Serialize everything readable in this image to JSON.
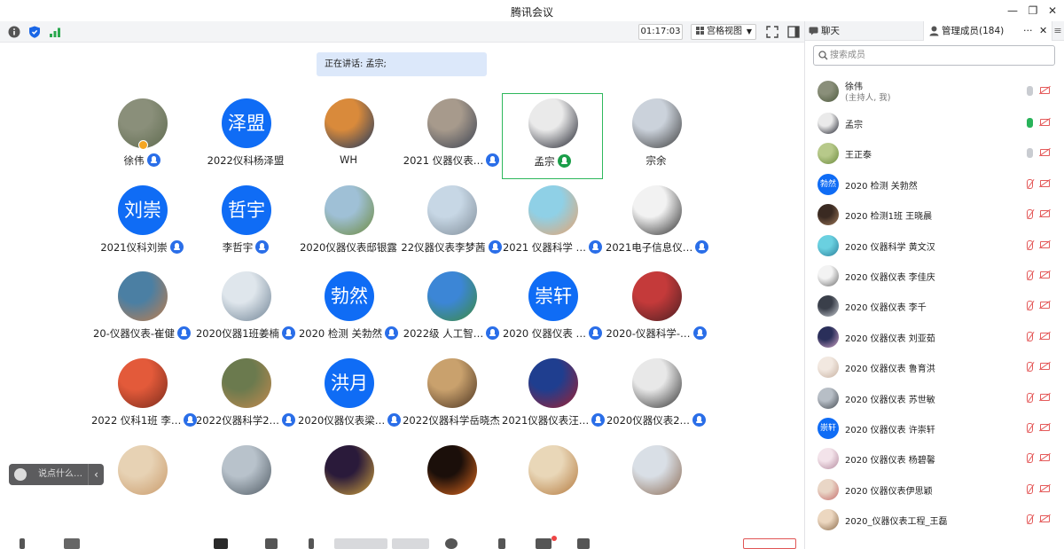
{
  "window": {
    "title": "腾讯会议",
    "minimize": "—",
    "restore": "❐",
    "close": "✕"
  },
  "toolbar": {
    "timer": "01:17:03",
    "view_mode": "宫格视图"
  },
  "speaking_banner": "正在讲话: 孟宗;",
  "colors": {
    "accent": "#0f6cf5",
    "speaking": "#2eb85c",
    "muted": "#e45a5a"
  },
  "tiles": [
    {
      "name": "徐伟",
      "type": "photo",
      "c1": "#8a8f7a",
      "c2": "#5e6a4e",
      "host": true
    },
    {
      "name": "2022仪科杨泽盟",
      "type": "text",
      "text": "泽盟"
    },
    {
      "name": "WH",
      "type": "photo",
      "c1": "#d98a3b",
      "c2": "#1b3760"
    },
    {
      "name": "2021 仪器仪表…",
      "type": "photo",
      "c1": "#a79a8c",
      "c2": "#3a4150",
      "mic": true
    },
    {
      "name": "孟宗",
      "type": "photo",
      "c1": "#eaeaea",
      "c2": "#1d1f2a",
      "active": true,
      "speak": true
    },
    {
      "name": "宗余",
      "type": "photo",
      "c1": "#cbd2db",
      "c2": "#3b3b3b"
    },
    {
      "name": "2021仪科刘崇",
      "type": "text",
      "text": "刘崇",
      "mic": true
    },
    {
      "name": "李哲宇",
      "type": "text",
      "text": "哲宇",
      "mic": true
    },
    {
      "name": "2020仪器仪表邸银露",
      "type": "photo",
      "c1": "#9fc0d6",
      "c2": "#6d8a3c"
    },
    {
      "name": "22仪器仪表李梦茜",
      "type": "photo",
      "c1": "#c7d7e5",
      "c2": "#7f8c98",
      "mic": true
    },
    {
      "name": "2021 仪器科学 …",
      "type": "photo",
      "c1": "#8fd0e6",
      "c2": "#e9a36d",
      "mic": true
    },
    {
      "name": "2021电子信息仪…",
      "type": "photo",
      "c1": "#f2f2f2",
      "c2": "#2a2a2a",
      "mic": true
    },
    {
      "name": "20-仪器仪表-崔健",
      "type": "photo",
      "c1": "#4b7fa3",
      "c2": "#c27d4a",
      "mic": true
    },
    {
      "name": "2020仪器1班姜楠",
      "type": "photo",
      "c1": "#dfe6ec",
      "c2": "#6e8294",
      "mic": true
    },
    {
      "name": "2020 检测 关勃然",
      "type": "text",
      "text": "勃然",
      "mic": true
    },
    {
      "name": "2022级 人工智…",
      "type": "photo",
      "c1": "#3c86d6",
      "c2": "#3d8b3d",
      "mic": true
    },
    {
      "name": "2020 仪器仪表 …",
      "type": "text",
      "text": "崇轩",
      "mic": true
    },
    {
      "name": "2020-仪器科学-…",
      "type": "photo",
      "c1": "#c43a3a",
      "c2": "#4a1f22",
      "mic": true
    },
    {
      "name": "2022 仪科1班 李…",
      "type": "photo",
      "c1": "#e35a3a",
      "c2": "#7a2b1c",
      "mic": true
    },
    {
      "name": "2022仪器科学2…",
      "type": "photo",
      "c1": "#6b7a4e",
      "c2": "#c48a4e",
      "mic": true
    },
    {
      "name": "2020仪器仪表梁…",
      "type": "text",
      "text": "洪月",
      "mic": true
    },
    {
      "name": "2022仪器科学岳晓杰",
      "type": "photo",
      "c1": "#c9a16d",
      "c2": "#4a3320"
    },
    {
      "name": "2021仪器仪表汪…",
      "type": "photo",
      "c1": "#1f3e8f",
      "c2": "#a31f2e",
      "mic": true
    },
    {
      "name": "2020仪器仪表2…",
      "type": "photo",
      "c1": "#e8e8e8",
      "c2": "#303030",
      "mic": true
    },
    {
      "name": "",
      "type": "photo",
      "c1": "#e7d2b4",
      "c2": "#c99a6a"
    },
    {
      "name": "",
      "type": "photo",
      "c1": "#b8c2cb",
      "c2": "#4f5a63"
    },
    {
      "name": "",
      "type": "photo",
      "c1": "#2a1a3a",
      "c2": "#d2a43d"
    },
    {
      "name": "",
      "type": "photo",
      "c1": "#1b0f0a",
      "c2": "#e06a1e"
    },
    {
      "name": "",
      "type": "photo",
      "c1": "#e9d7b8",
      "c2": "#b3783c"
    },
    {
      "name": "",
      "type": "photo",
      "c1": "#d9dfe6",
      "c2": "#8b6a52"
    }
  ],
  "chat_input": {
    "placeholder": "说点什么…",
    "collapse": "‹"
  },
  "sidebar": {
    "tab_chat": "聊天",
    "tab_members": "管理成员(184)",
    "more": "···",
    "close": "✕",
    "menu": "≡",
    "search_placeholder": "搜索成员",
    "members": [
      {
        "name": "徐伟",
        "sub": "(主持人, 我)",
        "c1": "#8a8f7a",
        "c2": "#4d5a3d",
        "mic": "grey"
      },
      {
        "name": "孟宗",
        "c1": "#eaeaea",
        "c2": "#1d1f2a",
        "mic": "green"
      },
      {
        "name": "王正泰",
        "c1": "#b7c98a",
        "c2": "#6b8a3c",
        "mic": "grey"
      },
      {
        "name": "2020 检测 关勃然",
        "text": "勃然",
        "mic": "off"
      },
      {
        "name": "2020 检测1班 王晓晨",
        "c1": "#3a2a22",
        "c2": "#a07a5a",
        "mic": "off"
      },
      {
        "name": "2020 仪器科学 黄文汉",
        "c1": "#6ad0e0",
        "c2": "#2a7f9a",
        "mic": "off"
      },
      {
        "name": "2020 仪器仪表 李佳庆",
        "c1": "#f3f3f3",
        "c2": "#6a6a6a",
        "mic": "off"
      },
      {
        "name": "2020 仪器仪表 李千",
        "c1": "#3a3f4a",
        "c2": "#c8ccd2",
        "mic": "off"
      },
      {
        "name": "2020 仪器仪表 刘亚茹",
        "c1": "#2a2f5a",
        "c2": "#d0a4c6",
        "mic": "off"
      },
      {
        "name": "2020 仪器仪表 鲁育洪",
        "c1": "#f2e8e0",
        "c2": "#c6b0a0",
        "mic": "off"
      },
      {
        "name": "2020 仪器仪表 苏世敏",
        "c1": "#b7bec6",
        "c2": "#454b52",
        "mic": "off"
      },
      {
        "name": "2020 仪器仪表 许崇轩",
        "text": "崇轩",
        "mic": "off"
      },
      {
        "name": "2020 仪器仪表 杨碧馨",
        "c1": "#f3e3ea",
        "c2": "#b48a9e",
        "mic": "off"
      },
      {
        "name": "2020 仪器仪表伊思颖",
        "c1": "#e9d6c6",
        "c2": "#c46a6a",
        "mic": "off"
      },
      {
        "name": "2020_仪器仪表工程_王磊",
        "c1": "#ecd7c0",
        "c2": "#8a6a4a",
        "mic": "off"
      }
    ]
  }
}
